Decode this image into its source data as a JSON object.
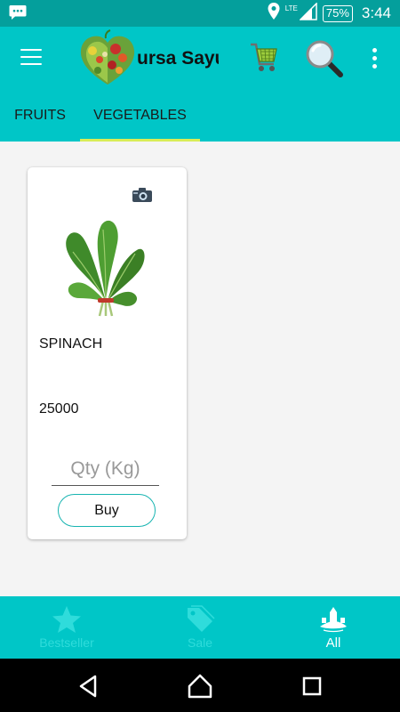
{
  "status_bar": {
    "network": "LTE",
    "battery": "75%",
    "time": "3:44",
    "icons": [
      "message-icon",
      "location-icon",
      "signal-icon",
      "battery-icon"
    ]
  },
  "app_bar": {
    "title": "ursa Sayur",
    "icons": [
      "menu-icon",
      "logo-icon",
      "cart-icon",
      "search-icon",
      "overflow-menu-icon"
    ]
  },
  "tabs": [
    {
      "label": "FRUITS",
      "selected": false
    },
    {
      "label": "VEGETABLES",
      "selected": true
    }
  ],
  "products": [
    {
      "name": "SPINACH",
      "price": "25000",
      "qty_placeholder": "Qty (Kg)",
      "qty_value": "",
      "buy_label": "Buy",
      "icons": [
        "camera-icon",
        "spinach-image"
      ]
    }
  ],
  "bottom_nav": [
    {
      "label": "Bestseller",
      "icon": "star-icon",
      "active": false
    },
    {
      "label": "Sale",
      "icon": "tag-icon",
      "active": false
    },
    {
      "label": "All",
      "icon": "island-icon",
      "active": true
    }
  ],
  "system_nav": [
    "back-icon",
    "home-icon",
    "recents-icon"
  ],
  "colors": {
    "status_bar": "#049f9c",
    "primary": "#00c6c7",
    "tab_indicator": "#d9ec56",
    "inactive_nav": "#2fdcdb",
    "buy_border": "#17b4b1"
  }
}
